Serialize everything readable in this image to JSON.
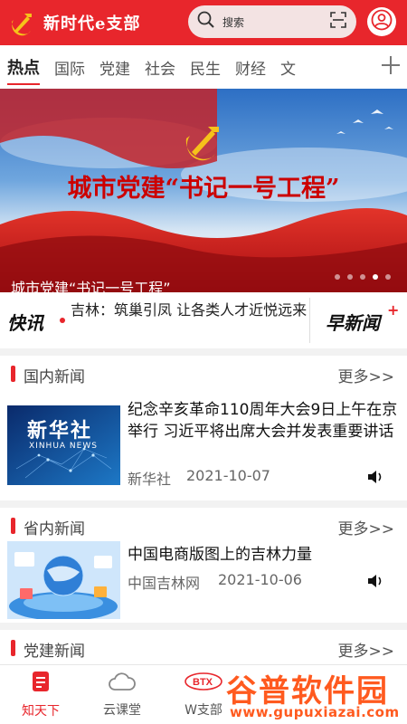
{
  "header": {
    "app_title": "新时代e支部",
    "search_placeholder": "搜索",
    "brand_color": "#e8262c"
  },
  "tabs": [
    {
      "label": "热点",
      "active": true
    },
    {
      "label": "国际",
      "active": false
    },
    {
      "label": "党建",
      "active": false
    },
    {
      "label": "社会",
      "active": false
    },
    {
      "label": "民生",
      "active": false
    },
    {
      "label": "财经",
      "active": false
    },
    {
      "label": "文",
      "active": false
    }
  ],
  "banner": {
    "headline": "城市党建“书记一号工程”",
    "caption": "城市党建“书记一号工程”",
    "slide_count": 5,
    "active_slide": 4
  },
  "flash": {
    "label": "快讯",
    "text": "吉林：筑巢引凤 让各类人才近悦远来",
    "morning_label": "早新闻",
    "morning_plus": "+"
  },
  "sections": {
    "domestic": {
      "title": "国内新闻",
      "more": "更多>>",
      "item": {
        "title": "纪念辛亥革命110周年大会9日上午在京举行 习近平将出席大会并发表重要讲话",
        "source": "新华社",
        "date": "2021-10-07",
        "thumb_text": "新华社",
        "thumb_subtext": "XINHUA NEWS"
      }
    },
    "provincial": {
      "title": "省内新闻",
      "more": "更多>>",
      "item": {
        "title": "中国电商版图上的吉林力量",
        "source": "中国吉林网",
        "date": "2021-10-06"
      }
    },
    "party": {
      "title": "党建新闻",
      "more": "更多>>"
    }
  },
  "bottom_nav": [
    {
      "label": "知天下",
      "icon": "news-doc-icon",
      "active": true
    },
    {
      "label": "云课堂",
      "icon": "cloud-icon",
      "active": false
    },
    {
      "label": "W支部",
      "icon": "btx-logo-icon",
      "active": false
    }
  ],
  "watermark": {
    "text": "谷普软件园",
    "url": "www.gupuxiazai.com"
  }
}
